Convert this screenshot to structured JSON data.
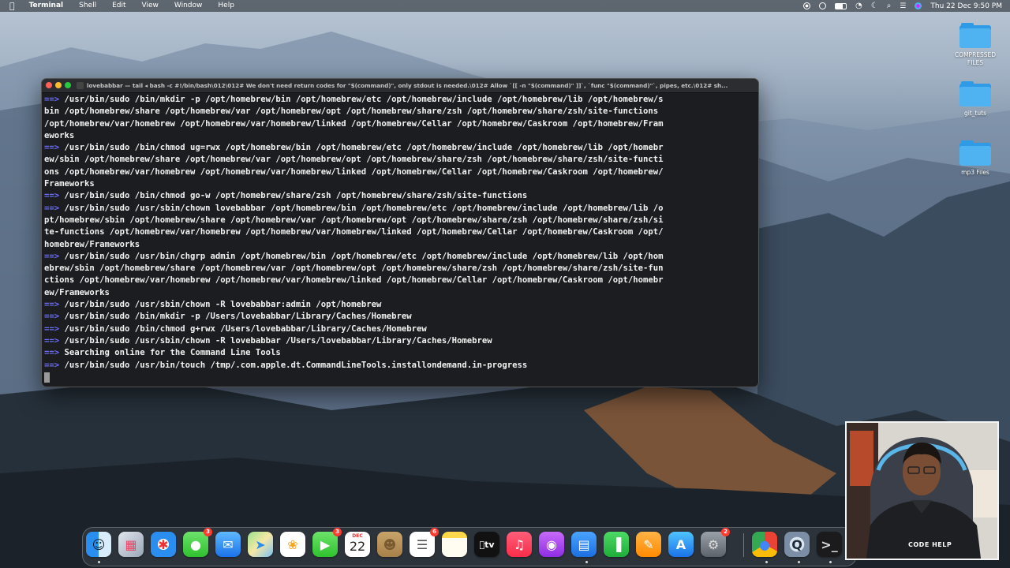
{
  "menubar": {
    "app": "Terminal",
    "items": [
      "Shell",
      "Edit",
      "View",
      "Window",
      "Help"
    ],
    "datetime": "Thu 22 Dec  9:50 PM"
  },
  "desktop_icons": [
    {
      "label": "COMPRESSED FILES"
    },
    {
      "label": "git_tuts"
    },
    {
      "label": "mp3 Files"
    }
  ],
  "terminal": {
    "title": "lovebabbar — tail ◂ bash -c #!/bin/bash\\012\\012# We don't need return codes for \"$(command)\", only stdout is needed.\\012# Allow `[[ -n \"$(command)\" ]]`, `func \"$(command)\"`, pipes, etc.\\012# sh...",
    "lines": [
      {
        "arrow": "==>",
        "text": " /usr/bin/sudo /bin/mkdir -p /opt/homebrew/bin /opt/homebrew/etc /opt/homebrew/include /opt/homebrew/lib /opt/homebrew/s"
      },
      {
        "arrow": "",
        "text": "bin /opt/homebrew/share /opt/homebrew/var /opt/homebrew/opt /opt/homebrew/share/zsh /opt/homebrew/share/zsh/site-functions"
      },
      {
        "arrow": "",
        "text": "/opt/homebrew/var/homebrew /opt/homebrew/var/homebrew/linked /opt/homebrew/Cellar /opt/homebrew/Caskroom /opt/homebrew/Fram"
      },
      {
        "arrow": "",
        "text": "eworks"
      },
      {
        "arrow": "==>",
        "text": " /usr/bin/sudo /bin/chmod ug=rwx /opt/homebrew/bin /opt/homebrew/etc /opt/homebrew/include /opt/homebrew/lib /opt/homebr"
      },
      {
        "arrow": "",
        "text": "ew/sbin /opt/homebrew/share /opt/homebrew/var /opt/homebrew/opt /opt/homebrew/share/zsh /opt/homebrew/share/zsh/site-functi"
      },
      {
        "arrow": "",
        "text": "ons /opt/homebrew/var/homebrew /opt/homebrew/var/homebrew/linked /opt/homebrew/Cellar /opt/homebrew/Caskroom /opt/homebrew/"
      },
      {
        "arrow": "",
        "text": "Frameworks"
      },
      {
        "arrow": "==>",
        "text": " /usr/bin/sudo /bin/chmod go-w /opt/homebrew/share/zsh /opt/homebrew/share/zsh/site-functions"
      },
      {
        "arrow": "==>",
        "text": " /usr/bin/sudo /usr/sbin/chown lovebabbar /opt/homebrew/bin /opt/homebrew/etc /opt/homebrew/include /opt/homebrew/lib /o"
      },
      {
        "arrow": "",
        "text": "pt/homebrew/sbin /opt/homebrew/share /opt/homebrew/var /opt/homebrew/opt /opt/homebrew/share/zsh /opt/homebrew/share/zsh/si"
      },
      {
        "arrow": "",
        "text": "te-functions /opt/homebrew/var/homebrew /opt/homebrew/var/homebrew/linked /opt/homebrew/Cellar /opt/homebrew/Caskroom /opt/"
      },
      {
        "arrow": "",
        "text": "homebrew/Frameworks"
      },
      {
        "arrow": "==>",
        "text": " /usr/bin/sudo /usr/bin/chgrp admin /opt/homebrew/bin /opt/homebrew/etc /opt/homebrew/include /opt/homebrew/lib /opt/hom"
      },
      {
        "arrow": "",
        "text": "ebrew/sbin /opt/homebrew/share /opt/homebrew/var /opt/homebrew/opt /opt/homebrew/share/zsh /opt/homebrew/share/zsh/site-fun"
      },
      {
        "arrow": "",
        "text": "ctions /opt/homebrew/var/homebrew /opt/homebrew/var/homebrew/linked /opt/homebrew/Cellar /opt/homebrew/Caskroom /opt/homebr"
      },
      {
        "arrow": "",
        "text": "ew/Frameworks"
      },
      {
        "arrow": "==>",
        "text": " /usr/bin/sudo /usr/sbin/chown -R lovebabbar:admin /opt/homebrew"
      },
      {
        "arrow": "==>",
        "text": " /usr/bin/sudo /bin/mkdir -p /Users/lovebabbar/Library/Caches/Homebrew"
      },
      {
        "arrow": "==>",
        "text": " /usr/bin/sudo /bin/chmod g+rwx /Users/lovebabbar/Library/Caches/Homebrew"
      },
      {
        "arrow": "==>",
        "text": " /usr/bin/sudo /usr/sbin/chown -R lovebabbar /Users/lovebabbar/Library/Caches/Homebrew"
      },
      {
        "arrow": "==>",
        "text": " Searching online for the Command Line Tools"
      },
      {
        "arrow": "==>",
        "text": " /usr/bin/sudo /usr/bin/touch /tmp/.com.apple.dt.CommandLineTools.installondemand.in-progress"
      }
    ]
  },
  "dock": {
    "calendar": {
      "month": "DEC",
      "day": "22"
    },
    "tv_label": "tv",
    "badges": {
      "messages": "3",
      "facetime": "3",
      "reminders": "6",
      "settings": "2"
    }
  },
  "webcam": {
    "watermark": "CODE HELP"
  },
  "colors": {
    "arrow": "#6a6cff",
    "terminal_bg": "#1c1d20",
    "folder": "#3aa6ea"
  }
}
